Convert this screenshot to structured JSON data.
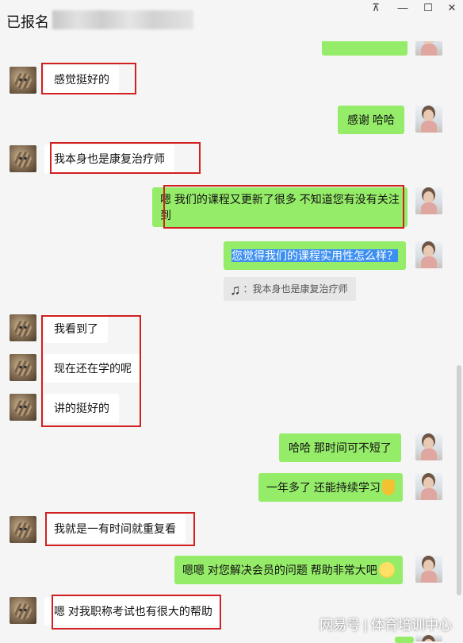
{
  "title": "已报名",
  "window_controls": {
    "pin": "⊼",
    "minimize": "—",
    "maximize": "☐",
    "close": "✕"
  },
  "messages": [
    {
      "side": "left",
      "text": "感觉挺好的"
    },
    {
      "side": "right",
      "text": "感谢  哈哈"
    },
    {
      "side": "left",
      "text": "我本身也是康复治疗师"
    },
    {
      "side": "right",
      "text": "嗯 我们的课程又更新了很多 不知道您有没有关注到"
    },
    {
      "side": "right",
      "text": "您觉得我们的课程实用性怎么样？"
    },
    {
      "side": "quote",
      "text": "：我本身也是康复治疗师"
    },
    {
      "side": "left",
      "text": "我看到了"
    },
    {
      "side": "left",
      "text": "现在还在学的呢"
    },
    {
      "side": "left",
      "text": "讲的挺好的"
    },
    {
      "side": "right",
      "text": "哈哈 那时间可不短了"
    },
    {
      "side": "right",
      "text": "一年多了 还能持续学习"
    },
    {
      "side": "left",
      "text": "我就是一有时间就重复看"
    },
    {
      "side": "right",
      "text": "嗯嗯  对您解决会员的问题 帮助非常大吧"
    },
    {
      "side": "left",
      "text": "嗯 对我职称考试也有很大的帮助"
    }
  ],
  "watermark": "网易号 | 体育培训中心",
  "colors": {
    "right_bubble": "#95ec69",
    "left_bubble": "#ffffff",
    "highlight_box": "#d21f1f",
    "selection": "#3d8ff2"
  }
}
